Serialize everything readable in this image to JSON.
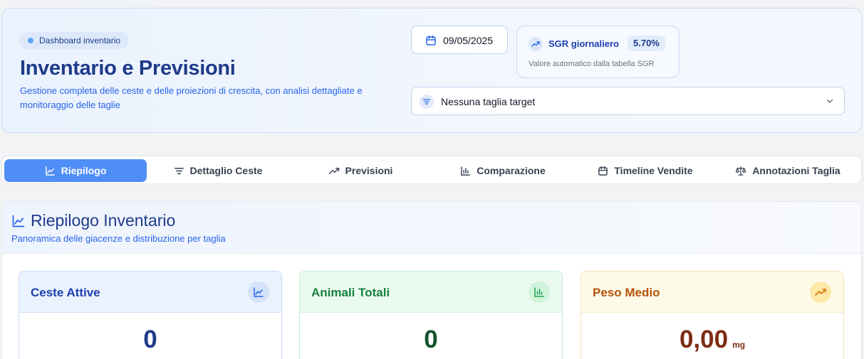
{
  "header": {
    "badge": "Dashboard inventario",
    "title": "Inventario e Previsioni",
    "subtitle": "Gestione completa delle ceste e delle proiezioni di crescita, con analisi dettagliate e monitoraggio delle taglie",
    "date": "09/05/2025",
    "sgr": {
      "label": "SGR giornaliero",
      "value": "5.70%",
      "note": "Valore automatico dalla tabella SGR"
    },
    "size_select": {
      "value": "Nessuna taglia target"
    }
  },
  "tabs": [
    {
      "label": "Riepilogo",
      "icon": "line-chart-icon",
      "active": true
    },
    {
      "label": "Dettaglio Ceste",
      "icon": "filter-icon",
      "active": false
    },
    {
      "label": "Previsioni",
      "icon": "trending-up-icon",
      "active": false
    },
    {
      "label": "Comparazione",
      "icon": "bar-chart-icon",
      "active": false
    },
    {
      "label": "Timeline Vendite",
      "icon": "calendar-icon",
      "active": false
    },
    {
      "label": "Annotazioni Taglia",
      "icon": "scale-icon",
      "active": false
    }
  ],
  "summary": {
    "title": "Riepilogo Inventario",
    "subtitle": "Panoramica delle giacenze e distribuzione per taglia",
    "cards": [
      {
        "title": "Ceste Attive",
        "value": "0",
        "unit": "",
        "icon": "line-chart-icon",
        "color": "#1e40af"
      },
      {
        "title": "Animali Totali",
        "value": "0",
        "unit": "",
        "icon": "bar-chart-icon",
        "color": "#15803d"
      },
      {
        "title": "Peso Medio",
        "value": "0,00",
        "unit": "mg",
        "icon": "trending-up-icon",
        "color": "#b45309"
      }
    ]
  },
  "colors": {
    "accent": "#4f8ef7",
    "title": "#1e3a8a"
  }
}
